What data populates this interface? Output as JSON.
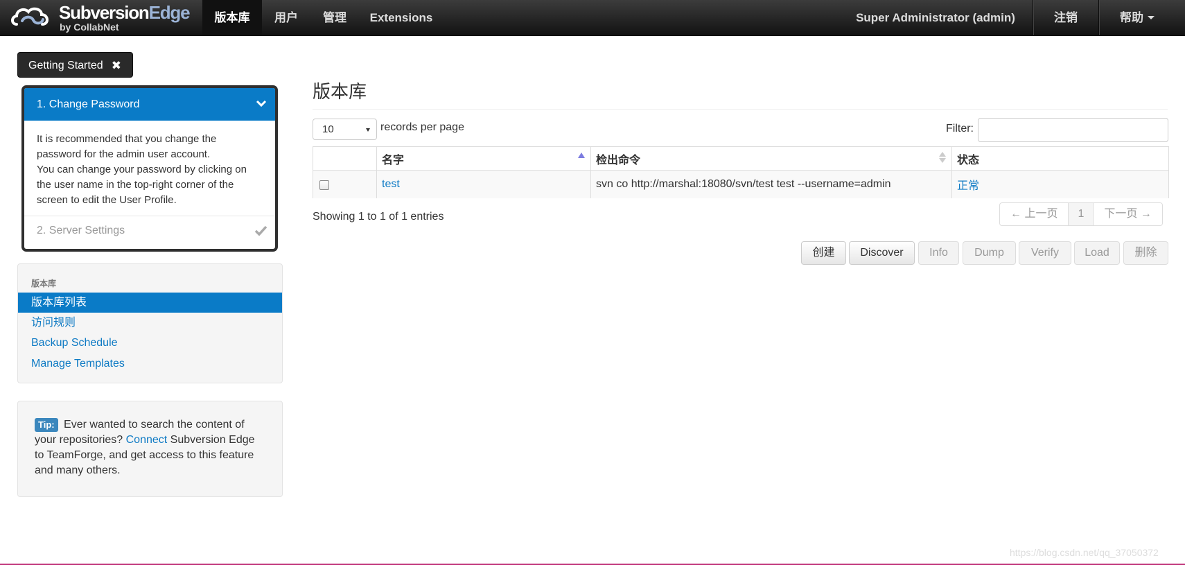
{
  "navbar": {
    "brand": {
      "name_main": "Subversion",
      "name_accent": "Edge",
      "sub": "by CollabNet"
    },
    "items": [
      {
        "label": "版本库",
        "active": true
      },
      {
        "label": "用户"
      },
      {
        "label": "管理"
      },
      {
        "label": "Extensions"
      }
    ],
    "user": "Super Administrator (admin)",
    "logout": "注销",
    "help": "帮助"
  },
  "getting_started": {
    "button_label": "Getting Started",
    "close_glyph": "✖",
    "step1": {
      "label": "1. Change Password",
      "body_line1": "It is recommended that you change the password for the admin user account.",
      "body_line2": "You can change your password by clicking on the user name in the top-right corner of the screen to edit the User Profile."
    },
    "step2": {
      "label": "2. Server Settings"
    }
  },
  "sidebar": {
    "header": "版本库",
    "items": [
      {
        "label": "版本库列表",
        "active": true
      },
      {
        "label": "访问规则"
      },
      {
        "label": "Backup Schedule"
      },
      {
        "label": "Manage Templates"
      }
    ]
  },
  "tip": {
    "badge": "Tip:",
    "text_before": "Ever wanted to search the content of your repositories?",
    "link": "Connect",
    "text_after": "Subversion Edge to TeamForge, and get access to this feature and many others."
  },
  "main": {
    "title": "版本库",
    "page_length": "10",
    "page_length_label": "records per page",
    "filter_label": "Filter:",
    "filter_value": "",
    "columns": [
      "名字",
      "检出命令",
      "状态"
    ],
    "rows": [
      {
        "name": "test",
        "checkout": "svn co http://marshal:18080/svn/test test --username=admin",
        "status": "正常"
      }
    ],
    "info": "Showing 1 to 1 of 1 entries",
    "pager": {
      "prev": "← 上一页",
      "current": "1",
      "next": "下一页 →"
    },
    "buttons": {
      "create": "创建",
      "discover": "Discover",
      "info": "Info",
      "dump": "Dump",
      "verify": "Verify",
      "load": "Load",
      "delete": "删除"
    }
  },
  "watermark": "https://blog.csdn.net/qq_37050372",
  "colors": {
    "accent": "#0a7bc7",
    "link": "#0e7ac4",
    "navbar": "#1e1e1e"
  }
}
